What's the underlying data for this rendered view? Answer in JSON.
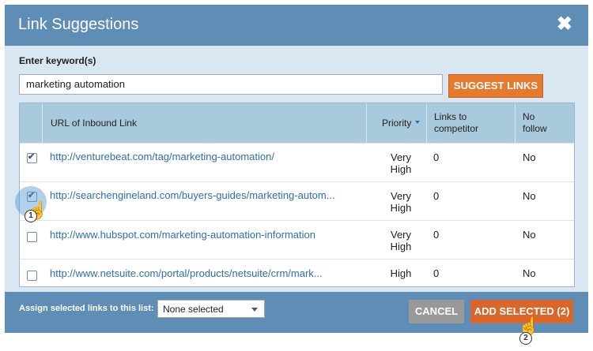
{
  "dialog": {
    "title": "Link Suggestions",
    "close_icon": "✖"
  },
  "keyword": {
    "label": "Enter keyword(s)",
    "value": "marketing automation"
  },
  "suggest_button": "SUGGEST LINKS",
  "table": {
    "headers": {
      "url": "URL of Inbound Link",
      "priority": "Priority",
      "competitor": [
        "Links to",
        "competitor"
      ],
      "nofollow": [
        "No",
        "follow"
      ]
    },
    "rows": [
      {
        "checked": true,
        "url": "http://venturebeat.com/tag/marketing-automation/",
        "priority": [
          "Very",
          "High"
        ],
        "competitor": "0",
        "nofollow": "No"
      },
      {
        "checked": true,
        "url": "http://searchengineland.com/buyers-guides/marketing-autom...",
        "priority": [
          "Very",
          "High"
        ],
        "competitor": "0",
        "nofollow": "No"
      },
      {
        "checked": false,
        "url": "http://www.hubspot.com/marketing-automation-information",
        "priority": [
          "Very",
          "High"
        ],
        "competitor": "0",
        "nofollow": "No"
      },
      {
        "checked": false,
        "url": "http://www.netsuite.com/portal/products/netsuite/crm/mark...",
        "priority": [
          "High"
        ],
        "competitor": "0",
        "nofollow": "No"
      }
    ]
  },
  "footer": {
    "assign_label": "Assign selected links to this list:",
    "list_select": "None selected",
    "cancel": "CANCEL",
    "add_selected": "ADD SELECTED (2)"
  },
  "callouts": [
    "1",
    "2"
  ],
  "colors": {
    "header_bg": "#5e8eb6",
    "body_bg": "#d8e7f2",
    "accent_orange": "#e47a2e",
    "link": "#2d6fb0"
  }
}
